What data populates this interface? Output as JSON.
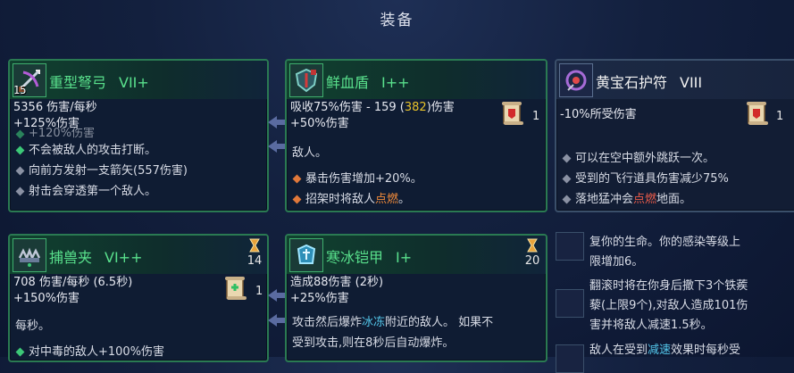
{
  "title": "装备",
  "cards": {
    "crossbow": {
      "icon": "crossbow-icon",
      "level": "15",
      "name": "重型弩弓",
      "tier": "VII+",
      "dps": "5356 伤害/每秒",
      "bonus": "+125%伤害",
      "lines": [
        "+120%伤害",
        "不会被敌人的攻击打断。",
        "向前方发射一支箭矢(557伤害)",
        "射击会穿透第一个敌人。"
      ]
    },
    "bloodshield": {
      "icon": "shield-icon",
      "name": "鲜血盾",
      "tier": "I++",
      "absorb_pre": "吸收75%伤害 - 159 (",
      "absorb_val": "382",
      "absorb_post": ")伤害",
      "bonus": "+50%伤害",
      "scroll_count": "1",
      "lines": [
        "敌人。",
        "暴击伤害增加+20%。"
      ],
      "parry_pre": "招架时将敌人",
      "parry_hl": "点燃",
      "parry_post": "。"
    },
    "ruby": {
      "icon": "amulet-icon",
      "name": "黄宝石护符",
      "tier": "VIII",
      "stat": "-10%所受伤害",
      "scroll_count": "1",
      "lines": [
        "可以在空中额外跳跃一次。",
        "受到的飞行道具伤害减少75%"
      ],
      "land_pre": "落地猛冲会",
      "land_hl": "点燃",
      "land_post": "地面。"
    },
    "trap": {
      "icon": "trap-icon",
      "name": "捕兽夹",
      "tier": "VI++",
      "cooldown": "14",
      "dps": "708 伤害/每秒 (6.5秒)",
      "bonus": "+150%伤害",
      "scroll_count": "1",
      "lines": [
        "每秒。",
        "对中毒的敌人+100%伤害"
      ]
    },
    "icearmor": {
      "icon": "ice-armor-icon",
      "name": "寒冰铠甲",
      "tier": "I+",
      "cooldown": "20",
      "dmg": "造成88伤害 (2秒)",
      "bonus": "+25%伤害",
      "line1_pre": "攻击然后爆炸",
      "line1_hl": "冰冻",
      "line1_post": "附近的敌人。 如果不",
      "line2": "受到攻击,则在8秒后自动爆炸。"
    }
  },
  "side_mutations": {
    "m1": [
      "复你的生命。你的感染等级上",
      "限增加6。"
    ],
    "m2": [
      "翻滚时将在你身后撒下3个铁蒺",
      "藜(上限9个),对敌人造成101伤",
      "害并将敌人减速1.5秒。"
    ],
    "m3_pre": "敌人在受到",
    "m3_hl": "减速",
    "m3_post": "效果时每秒受"
  }
}
